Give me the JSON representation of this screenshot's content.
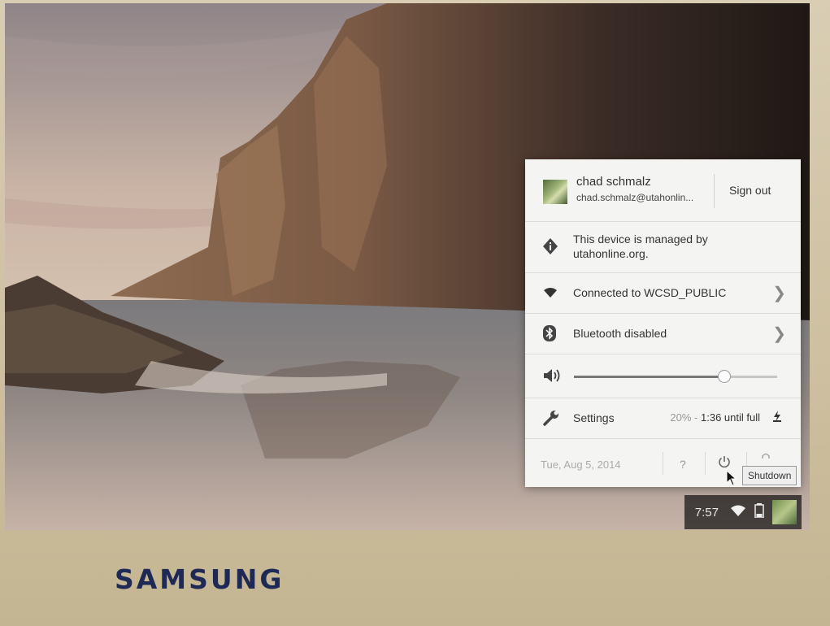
{
  "brand": "SAMSUNG",
  "user": {
    "name": "chad schmalz",
    "email": "chad.schmalz@utahonlin...",
    "sign_out_label": "Sign out"
  },
  "managed": {
    "line1": "This device is managed by",
    "line2": "utahonline.org."
  },
  "network": {
    "label": "Connected to WCSD_PUBLIC"
  },
  "bluetooth": {
    "label": "Bluetooth disabled"
  },
  "volume": {
    "level": 0.74
  },
  "settings": {
    "label": "Settings",
    "battery_percent": "20%",
    "battery_sep": " - ",
    "battery_time": "1:36 until full"
  },
  "footer": {
    "date": "Tue, Aug 5, 2014",
    "help": "?"
  },
  "tooltip": {
    "text": "Shutdown"
  },
  "shelf": {
    "time": "7:57"
  },
  "icons": {
    "managed": "info-diamond-icon",
    "wifi": "wifi-icon",
    "bluetooth": "bluetooth-icon",
    "volume": "speaker-icon",
    "settings": "wrench-icon",
    "power": "power-icon",
    "lock": "lock-icon",
    "battery": "battery-icon",
    "chevron": "chevron-right-icon"
  }
}
